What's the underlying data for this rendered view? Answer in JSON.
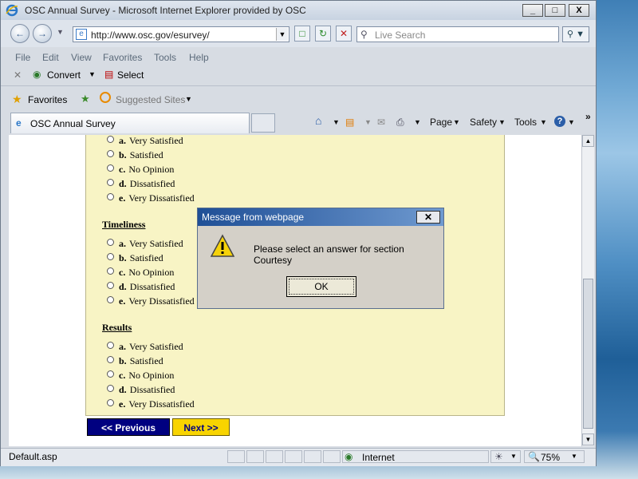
{
  "window": {
    "title": "OSC Annual Survey - Microsoft Internet Explorer provided by OSC",
    "controls": {
      "minimize": "_",
      "maximize": "□",
      "close": "X"
    }
  },
  "navbar": {
    "url": "http://www.osc.gov/esurvey/",
    "search_placeholder": "Live Search"
  },
  "menu": [
    "File",
    "Edit",
    "View",
    "Favorites",
    "Tools",
    "Help"
  ],
  "commandbar": {
    "convert": "Convert",
    "select": "Select"
  },
  "favbar": {
    "favorites": "Favorites",
    "suggested": "Suggested Sites"
  },
  "tab": {
    "label": "OSC Annual Survey"
  },
  "toolbar": {
    "page": "Page",
    "safety": "Safety",
    "tools": "Tools"
  },
  "survey": {
    "sections": [
      {
        "title": "",
        "options": [
          {
            "letter": "a.",
            "text": "Very Satisfied"
          },
          {
            "letter": "b.",
            "text": "Satisfied"
          },
          {
            "letter": "c.",
            "text": "No Opinion"
          },
          {
            "letter": "d.",
            "text": "Dissatisfied"
          },
          {
            "letter": "e.",
            "text": "Very Dissatisfied"
          }
        ]
      },
      {
        "title": "Timeliness",
        "options": [
          {
            "letter": "a.",
            "text": "Very Satisfied"
          },
          {
            "letter": "b.",
            "text": "Satisfied"
          },
          {
            "letter": "c.",
            "text": "No Opinion"
          },
          {
            "letter": "d.",
            "text": "Dissatisfied"
          },
          {
            "letter": "e.",
            "text": "Very Dissatisfied"
          }
        ]
      },
      {
        "title": "Results",
        "options": [
          {
            "letter": "a.",
            "text": "Very Satisfied"
          },
          {
            "letter": "b.",
            "text": "Satisfied"
          },
          {
            "letter": "c.",
            "text": "No Opinion"
          },
          {
            "letter": "d.",
            "text": "Dissatisfied"
          },
          {
            "letter": "e.",
            "text": "Very Dissatisfied"
          }
        ]
      }
    ],
    "prev_label": "<< Previous",
    "next_label": "Next >>"
  },
  "dialog": {
    "title": "Message from webpage",
    "close": "✕",
    "message": "Please select an answer for section Courtesy",
    "ok_label": "OK"
  },
  "status": {
    "text": "Default.asp",
    "zone": "Internet",
    "zoom": "75%"
  },
  "colors": {
    "form_bg": "#f8f4c5",
    "prev_bg": "#000080",
    "next_bg": "#f8d400",
    "dialog_title": "#1f4f96"
  }
}
